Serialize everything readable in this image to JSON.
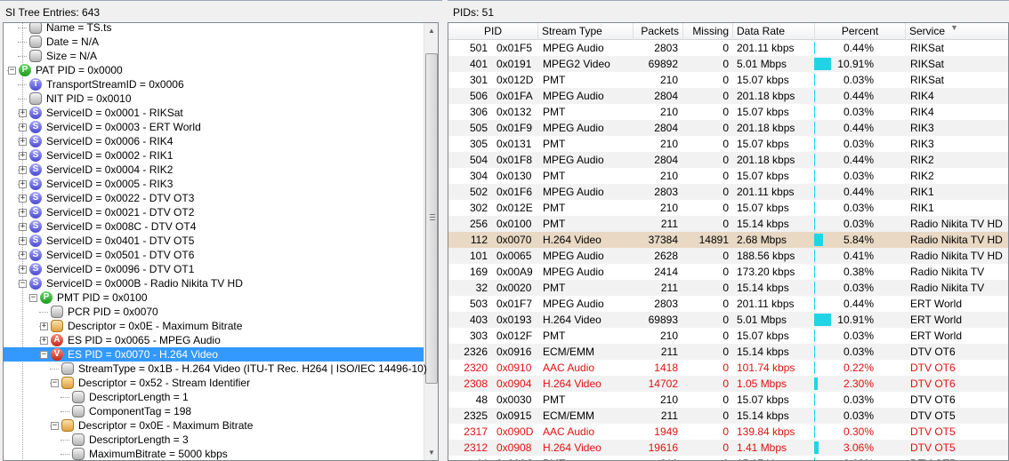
{
  "left_header": "SI Tree Entries: 643",
  "right_header": "PIDs: 51",
  "colors": {
    "selection": "#3399ff",
    "bar": "#1dd5e5",
    "error_text": "#e01010",
    "highlight_row": "#e8d8c4"
  },
  "tree": [
    {
      "indent": 2,
      "icon": "grey",
      "letter": "",
      "expander": "",
      "label": "Name = TS.ts"
    },
    {
      "indent": 2,
      "icon": "grey",
      "letter": "",
      "expander": "",
      "label": "Date = N/A"
    },
    {
      "indent": 2,
      "icon": "grey",
      "letter": "",
      "expander": "",
      "label": "Size = N/A"
    },
    {
      "indent": 1,
      "icon": "green",
      "letter": "P",
      "expander": "−",
      "label": "PAT PID = 0x0000"
    },
    {
      "indent": 2,
      "icon": "purple",
      "letter": "T",
      "expander": "",
      "label": "TransportStreamID = 0x0006"
    },
    {
      "indent": 2,
      "icon": "grey",
      "letter": "",
      "expander": "",
      "label": "NIT PID = 0x0010"
    },
    {
      "indent": 2,
      "icon": "purple",
      "letter": "S",
      "expander": "+",
      "label": "ServiceID = 0x0001 - RIKSat"
    },
    {
      "indent": 2,
      "icon": "purple",
      "letter": "S",
      "expander": "+",
      "label": "ServiceID = 0x0003 - ERT World"
    },
    {
      "indent": 2,
      "icon": "purple",
      "letter": "S",
      "expander": "+",
      "label": "ServiceID = 0x0006 - RIK4"
    },
    {
      "indent": 2,
      "icon": "purple",
      "letter": "S",
      "expander": "+",
      "label": "ServiceID = 0x0002 - RIK1"
    },
    {
      "indent": 2,
      "icon": "purple",
      "letter": "S",
      "expander": "+",
      "label": "ServiceID = 0x0004 - RIK2"
    },
    {
      "indent": 2,
      "icon": "purple",
      "letter": "S",
      "expander": "+",
      "label": "ServiceID = 0x0005 - RIK3"
    },
    {
      "indent": 2,
      "icon": "purple",
      "letter": "S",
      "expander": "+",
      "label": "ServiceID = 0x0022 - DTV OT3"
    },
    {
      "indent": 2,
      "icon": "purple",
      "letter": "S",
      "expander": "+",
      "label": "ServiceID = 0x0021 - DTV OT2"
    },
    {
      "indent": 2,
      "icon": "purple",
      "letter": "S",
      "expander": "+",
      "label": "ServiceID = 0x008C - DTV OT4"
    },
    {
      "indent": 2,
      "icon": "purple",
      "letter": "S",
      "expander": "+",
      "label": "ServiceID = 0x0401 - DTV OT5"
    },
    {
      "indent": 2,
      "icon": "purple",
      "letter": "S",
      "expander": "+",
      "label": "ServiceID = 0x0501 - DTV OT6"
    },
    {
      "indent": 2,
      "icon": "purple",
      "letter": "S",
      "expander": "+",
      "label": "ServiceID = 0x0096 - DTV OT1"
    },
    {
      "indent": 2,
      "icon": "purple",
      "letter": "S",
      "expander": "−",
      "label": "ServiceID = 0x000B - Radio Nikita TV HD"
    },
    {
      "indent": 3,
      "icon": "green",
      "letter": "P",
      "expander": "−",
      "label": "PMT PID = 0x0100"
    },
    {
      "indent": 4,
      "icon": "grey",
      "letter": "",
      "expander": "",
      "label": "PCR PID = 0x0070"
    },
    {
      "indent": 4,
      "icon": "orange",
      "letter": "",
      "expander": "+",
      "label": "Descriptor = 0x0E - Maximum Bitrate"
    },
    {
      "indent": 4,
      "icon": "red",
      "letter": "A",
      "expander": "+",
      "label": "ES PID = 0x0065 - MPEG Audio"
    },
    {
      "indent": 4,
      "icon": "red",
      "letter": "V",
      "expander": "−",
      "label": "ES PID = 0x0070 - H.264 Video",
      "selected": true
    },
    {
      "indent": 5,
      "icon": "grey",
      "letter": "",
      "expander": "",
      "label": "StreamType = 0x1B - H.264 Video (ITU-T Rec. H264 | ISO/IEC 14496-10)"
    },
    {
      "indent": 5,
      "icon": "orange",
      "letter": "",
      "expander": "−",
      "label": "Descriptor = 0x52 - Stream Identifier"
    },
    {
      "indent": 6,
      "icon": "grey",
      "letter": "",
      "expander": "",
      "label": "DescriptorLength = 1"
    },
    {
      "indent": 6,
      "icon": "grey",
      "letter": "",
      "expander": "",
      "label": "ComponentTag = 198"
    },
    {
      "indent": 5,
      "icon": "orange",
      "letter": "",
      "expander": "−",
      "label": "Descriptor = 0x0E - Maximum Bitrate"
    },
    {
      "indent": 6,
      "icon": "grey",
      "letter": "",
      "expander": "",
      "label": "DescriptorLength = 3"
    },
    {
      "indent": 6,
      "icon": "grey",
      "letter": "",
      "expander": "",
      "label": "MaximumBitrate = 5000 kbps"
    }
  ],
  "table": {
    "columns": [
      "PID",
      "Stream Type",
      "Packets",
      "Missing",
      "Data Rate",
      "Percent",
      "Service"
    ],
    "sorted_column": "Service",
    "rows": [
      {
        "pid": "501",
        "hex": "0x01F5",
        "type": "MPEG Audio",
        "packets": "2803",
        "missing": "0",
        "rate": "201.11 kbps",
        "bar": 0.44,
        "percent": "0.44%",
        "service": "RIKSat"
      },
      {
        "pid": "401",
        "hex": "0x0191",
        "type": "MPEG2 Video",
        "packets": "69892",
        "missing": "0",
        "rate": "5.01 Mbps",
        "bar": 10.91,
        "percent": "10.91%",
        "service": "RIKSat"
      },
      {
        "pid": "301",
        "hex": "0x012D",
        "type": "PMT",
        "packets": "210",
        "missing": "0",
        "rate": "15.07 kbps",
        "bar": 0.03,
        "percent": "0.03%",
        "service": "RIKSat"
      },
      {
        "pid": "506",
        "hex": "0x01FA",
        "type": "MPEG Audio",
        "packets": "2804",
        "missing": "0",
        "rate": "201.18 kbps",
        "bar": 0.44,
        "percent": "0.44%",
        "service": "RIK4"
      },
      {
        "pid": "306",
        "hex": "0x0132",
        "type": "PMT",
        "packets": "210",
        "missing": "0",
        "rate": "15.07 kbps",
        "bar": 0.03,
        "percent": "0.03%",
        "service": "RIK4"
      },
      {
        "pid": "505",
        "hex": "0x01F9",
        "type": "MPEG Audio",
        "packets": "2804",
        "missing": "0",
        "rate": "201.18 kbps",
        "bar": 0.44,
        "percent": "0.44%",
        "service": "RIK3"
      },
      {
        "pid": "305",
        "hex": "0x0131",
        "type": "PMT",
        "packets": "210",
        "missing": "0",
        "rate": "15.07 kbps",
        "bar": 0.03,
        "percent": "0.03%",
        "service": "RIK3"
      },
      {
        "pid": "504",
        "hex": "0x01F8",
        "type": "MPEG Audio",
        "packets": "2804",
        "missing": "0",
        "rate": "201.18 kbps",
        "bar": 0.44,
        "percent": "0.44%",
        "service": "RIK2"
      },
      {
        "pid": "304",
        "hex": "0x0130",
        "type": "PMT",
        "packets": "210",
        "missing": "0",
        "rate": "15.07 kbps",
        "bar": 0.03,
        "percent": "0.03%",
        "service": "RIK2"
      },
      {
        "pid": "502",
        "hex": "0x01F6",
        "type": "MPEG Audio",
        "packets": "2803",
        "missing": "0",
        "rate": "201.11 kbps",
        "bar": 0.44,
        "percent": "0.44%",
        "service": "RIK1"
      },
      {
        "pid": "302",
        "hex": "0x012E",
        "type": "PMT",
        "packets": "210",
        "missing": "0",
        "rate": "15.07 kbps",
        "bar": 0.03,
        "percent": "0.03%",
        "service": "RIK1"
      },
      {
        "pid": "256",
        "hex": "0x0100",
        "type": "PMT",
        "packets": "211",
        "missing": "0",
        "rate": "15.14 kbps",
        "bar": 0.03,
        "percent": "0.03%",
        "service": "Radio Nikita TV HD"
      },
      {
        "pid": "112",
        "hex": "0x0070",
        "type": "H.264 Video",
        "packets": "37384",
        "missing": "14891",
        "rate": "2.68 Mbps",
        "bar": 5.84,
        "percent": "5.84%",
        "service": "Radio Nikita TV HD",
        "highlight": true
      },
      {
        "pid": "101",
        "hex": "0x0065",
        "type": "MPEG Audio",
        "packets": "2628",
        "missing": "0",
        "rate": "188.56 kbps",
        "bar": 0.41,
        "percent": "0.41%",
        "service": "Radio Nikita TV HD"
      },
      {
        "pid": "169",
        "hex": "0x00A9",
        "type": "MPEG Audio",
        "packets": "2414",
        "missing": "0",
        "rate": "173.20 kbps",
        "bar": 0.38,
        "percent": "0.38%",
        "service": "Radio Nikita TV"
      },
      {
        "pid": "32",
        "hex": "0x0020",
        "type": "PMT",
        "packets": "211",
        "missing": "0",
        "rate": "15.14 kbps",
        "bar": 0.03,
        "percent": "0.03%",
        "service": "Radio Nikita TV"
      },
      {
        "pid": "503",
        "hex": "0x01F7",
        "type": "MPEG Audio",
        "packets": "2803",
        "missing": "0",
        "rate": "201.11 kbps",
        "bar": 0.44,
        "percent": "0.44%",
        "service": "ERT World"
      },
      {
        "pid": "403",
        "hex": "0x0193",
        "type": "H.264 Video",
        "packets": "69893",
        "missing": "0",
        "rate": "5.01 Mbps",
        "bar": 10.91,
        "percent": "10.91%",
        "service": "ERT World"
      },
      {
        "pid": "303",
        "hex": "0x012F",
        "type": "PMT",
        "packets": "210",
        "missing": "0",
        "rate": "15.07 kbps",
        "bar": 0.03,
        "percent": "0.03%",
        "service": "ERT World"
      },
      {
        "pid": "2326",
        "hex": "0x0916",
        "type": "ECM/EMM",
        "packets": "211",
        "missing": "0",
        "rate": "15.14 kbps",
        "bar": 0.03,
        "percent": "0.03%",
        "service": "DTV OT6"
      },
      {
        "pid": "2320",
        "hex": "0x0910",
        "type": "AAC Audio",
        "packets": "1418",
        "missing": "0",
        "rate": "101.74 kbps",
        "bar": 0.22,
        "percent": "0.22%",
        "service": "DTV OT6",
        "red": true
      },
      {
        "pid": "2308",
        "hex": "0x0904",
        "type": "H.264 Video",
        "packets": "14702",
        "missing": "0",
        "rate": "1.05 Mbps",
        "bar": 2.3,
        "percent": "2.30%",
        "service": "DTV OT6",
        "red": true
      },
      {
        "pid": "48",
        "hex": "0x0030",
        "type": "PMT",
        "packets": "210",
        "missing": "0",
        "rate": "15.07 kbps",
        "bar": 0.03,
        "percent": "0.03%",
        "service": "DTV OT6"
      },
      {
        "pid": "2325",
        "hex": "0x0915",
        "type": "ECM/EMM",
        "packets": "211",
        "missing": "0",
        "rate": "15.14 kbps",
        "bar": 0.03,
        "percent": "0.03%",
        "service": "DTV OT5"
      },
      {
        "pid": "2317",
        "hex": "0x090D",
        "type": "AAC Audio",
        "packets": "1949",
        "missing": "0",
        "rate": "139.84 kbps",
        "bar": 0.3,
        "percent": "0.30%",
        "service": "DTV OT5",
        "red": true
      },
      {
        "pid": "2312",
        "hex": "0x0908",
        "type": "H.264 Video",
        "packets": "19616",
        "missing": "0",
        "rate": "1.41 Mbps",
        "bar": 3.06,
        "percent": "3.06%",
        "service": "DTV OT5",
        "red": true
      },
      {
        "pid": "44",
        "hex": "0x002C",
        "type": "PMT",
        "packets": "210",
        "missing": "0",
        "rate": "15.07 kbps",
        "bar": 0.03,
        "percent": "0.03%",
        "service": "DTV OT5"
      }
    ]
  }
}
